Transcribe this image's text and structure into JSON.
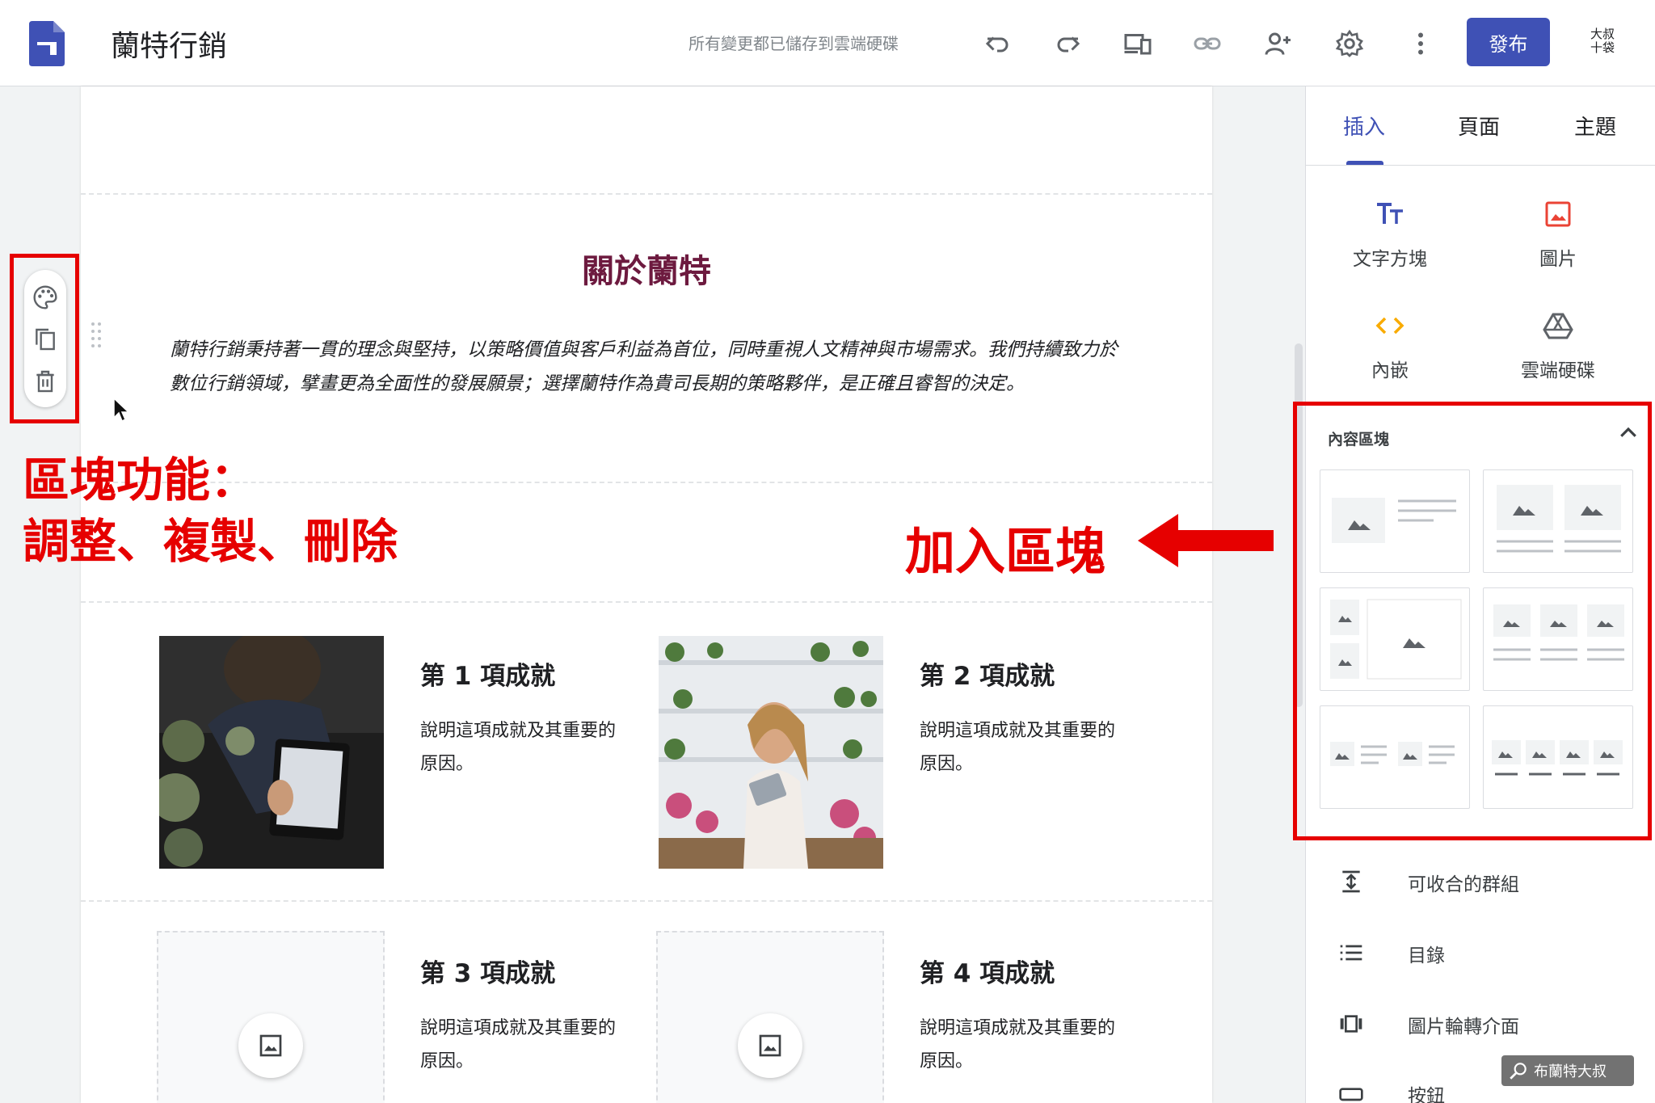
{
  "header": {
    "site_title": "蘭特行銷",
    "save_status": "所有變更都已儲存到雲端硬碟",
    "icons": [
      "undo-icon",
      "redo-icon",
      "preview-devices-icon",
      "link-icon",
      "share-person-icon",
      "settings-gear-icon",
      "more-vert-icon"
    ],
    "publish_label": "發布",
    "avatar_line1": "大叔",
    "avatar_line2": "十袋",
    "accent_color": "#3f51b5"
  },
  "canvas": {
    "about_title": "關於蘭特",
    "about_body": "蘭特行銷秉持著一貫的理念與堅持，以策略價值與客戶利益為首位，同時重視人文精神與市場需求。我們持續致力於數位行銷領域，擘畫更為全面性的發展願景；選擇蘭特作為貴司長期的策略夥伴，是正確且睿智的決定。",
    "achievements": [
      {
        "title": "第 1 項成就",
        "desc": "說明這項成就及其重要的原因。"
      },
      {
        "title": "第 2 項成就",
        "desc": "說明這項成就及其重要的原因。"
      },
      {
        "title": "第 3 項成就",
        "desc": "說明這項成就及其重要的原因。"
      },
      {
        "title": "第 4 項成就",
        "desc": "說明這項成就及其重要的原因。"
      }
    ],
    "title_color": "#6d1a3f"
  },
  "block_toolbar": {
    "icons": [
      "palette-icon",
      "copy-icon",
      "trash-icon"
    ]
  },
  "panel": {
    "tabs": [
      "插入",
      "頁面",
      "主題"
    ],
    "insert_items": [
      {
        "label": "文字方塊",
        "icon": "text-box-icon"
      },
      {
        "label": "圖片",
        "icon": "image-icon"
      },
      {
        "label": "內嵌",
        "icon": "embed-code-icon"
      },
      {
        "label": "雲端硬碟",
        "icon": "drive-icon"
      }
    ],
    "content_blocks_title": "內容區塊",
    "list_items": [
      {
        "label": "可收合的群組",
        "icon": "collapsible-group-icon"
      },
      {
        "label": "目錄",
        "icon": "table-of-contents-icon"
      },
      {
        "label": "圖片輪轉介面",
        "icon": "image-carousel-icon"
      },
      {
        "label": "按鈕",
        "icon": "button-icon"
      }
    ]
  },
  "annotations": {
    "left_line1": "區塊功能：",
    "left_line2": "調整、複製、刪除",
    "right": "加入區塊",
    "color": "#e60000"
  },
  "watermark": "布蘭特大叔"
}
